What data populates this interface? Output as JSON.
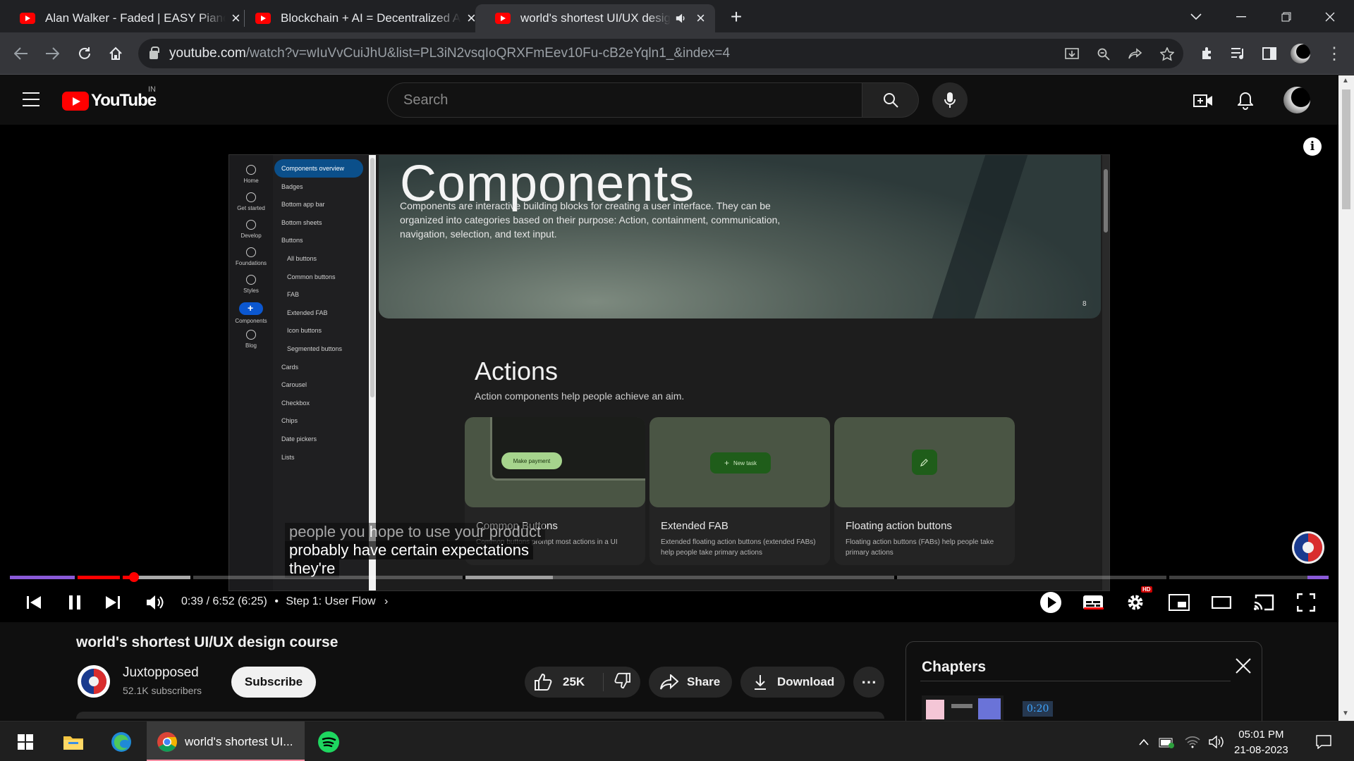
{
  "browser": {
    "tabs": [
      {
        "title": "Alan Walker - Faded | EASY Piano",
        "active": false
      },
      {
        "title": "Blockchain + AI = Decentralized A",
        "active": false
      },
      {
        "title": "world's shortest UI/UX design",
        "active": true
      }
    ],
    "url_host": "youtube.com",
    "url_path": "/watch?v=wIuVvCuiJhU&list=PL3iN2vsqIoQRXFmEev10Fu-cB2eYqln1_&index=4"
  },
  "youtube": {
    "logo_text": "YouTube",
    "country_code": "IN",
    "search_placeholder": "Search"
  },
  "video_frame": {
    "rail": [
      "Home",
      "Get started",
      "Develop",
      "Foundations",
      "Styles",
      "Components",
      "Blog"
    ],
    "nav": [
      {
        "label": "Components overview",
        "kind": "sel"
      },
      {
        "label": "Badges",
        "kind": "top"
      },
      {
        "label": "Bottom app bar",
        "kind": "top"
      },
      {
        "label": "Bottom sheets",
        "kind": "top"
      },
      {
        "label": "Buttons",
        "kind": "top"
      },
      {
        "label": "All buttons",
        "kind": "sub"
      },
      {
        "label": "Common buttons",
        "kind": "sub"
      },
      {
        "label": "FAB",
        "kind": "sub"
      },
      {
        "label": "Extended FAB",
        "kind": "sub"
      },
      {
        "label": "Icon buttons",
        "kind": "sub"
      },
      {
        "label": "Segmented buttons",
        "kind": "sub"
      },
      {
        "label": "Cards",
        "kind": "top"
      },
      {
        "label": "Carousel",
        "kind": "top"
      },
      {
        "label": "Checkbox",
        "kind": "top"
      },
      {
        "label": "Chips",
        "kind": "top"
      },
      {
        "label": "Date pickers",
        "kind": "top"
      },
      {
        "label": "Lists",
        "kind": "top"
      }
    ],
    "hero_title": "Components",
    "hero_desc": "Components are interactive building blocks for creating a user interface. They can be organized into categories based on their purpose: Action, containment, communication, navigation, selection, and text input.",
    "hero_badge": "8",
    "actions_title": "Actions",
    "actions_desc": "Action components help people achieve an aim.",
    "cards": [
      {
        "title": "Common Buttons",
        "desc": "Common buttons prompt most actions in a UI",
        "pill": "Make payment"
      },
      {
        "title": "Extended FAB",
        "desc": "Extended floating action buttons (extended FABs) help people take primary actions",
        "pill": "New task"
      },
      {
        "title": "Floating action buttons",
        "desc": "Floating action buttons (FABs) help people take primary actions",
        "pill": ""
      }
    ]
  },
  "captions": [
    "people you hope to use your product",
    "probably have certain expectations",
    "they're"
  ],
  "player": {
    "timecode": "0:39 / 6:52 (6:25)",
    "chapter": "Step 1: User Flow",
    "progress_fraction": 0.094,
    "hd_badge": "HD"
  },
  "video": {
    "title": "world's shortest UI/UX design course",
    "channel": "Juxtopposed",
    "subscribers": "52.1K subscribers",
    "subscribe_label": "Subscribe",
    "likes": "25K",
    "share_label": "Share",
    "download_label": "Download"
  },
  "chapters": {
    "title": "Chapters",
    "first_time": "0:20"
  },
  "taskbar": {
    "chrome_label": "world's shortest UI...",
    "time": "05:01 PM",
    "date": "21-08-2023"
  },
  "colors": {
    "yt_red": "#ff0000",
    "progress_red": "#ff0000",
    "chapter_time_blue": "#3ea6ff"
  }
}
